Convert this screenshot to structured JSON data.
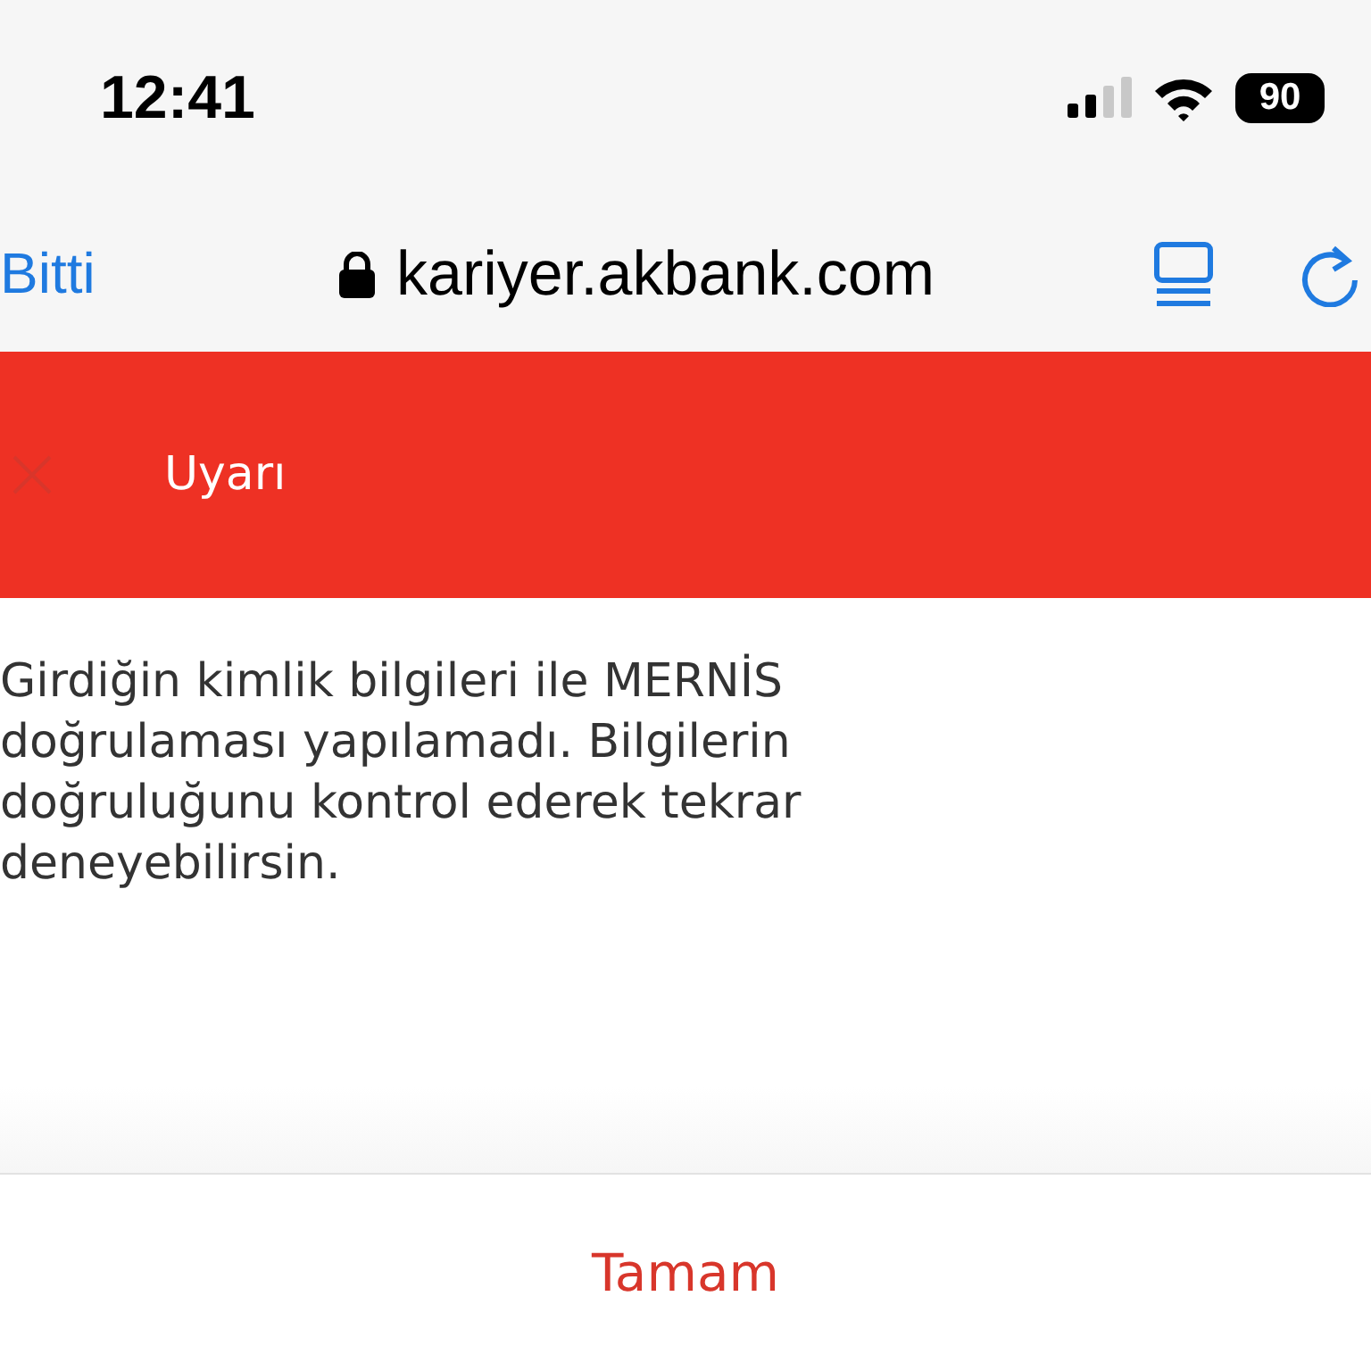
{
  "status_bar": {
    "time": "12:41",
    "battery": "90"
  },
  "browser_bar": {
    "done": "Bitti",
    "url": "kariyer.akbank.com"
  },
  "dialog": {
    "title": "Uyarı",
    "message": "Girdiğin kimlik bilgileri ile MERNİS doğrulaması yapılamadı. Bilgilerin doğruluğunu kontrol ederek tekrar deneyebilirsin.",
    "buttons": [
      "Tamam"
    ]
  }
}
